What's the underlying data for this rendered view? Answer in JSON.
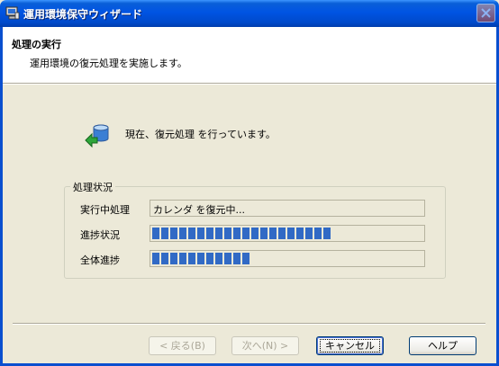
{
  "window": {
    "title": "運用環境保守ウィザード",
    "title_icon": "computer-icon",
    "close_icon": "close-icon"
  },
  "header": {
    "title": "処理の実行",
    "description": "運用環境の復元処理を実施します。"
  },
  "status": {
    "icon": "database-restore-icon",
    "message": "現在、復元処理 を行っています。"
  },
  "group": {
    "label": "処理状況",
    "current_task": {
      "label": "実行中処理",
      "value": "カレンダ を復元中..."
    },
    "progress": {
      "label": "進捗状況",
      "value": 0.67
    },
    "overall": {
      "label": "全体進捗",
      "value": 0.36
    }
  },
  "buttons": {
    "back": "< 戻る(B)",
    "next": "次へ(N) >",
    "cancel": "キャンセル",
    "help": "ヘルプ"
  },
  "colors": {
    "progress_fill": "#316ac5",
    "titlebar": "#0054e3"
  }
}
